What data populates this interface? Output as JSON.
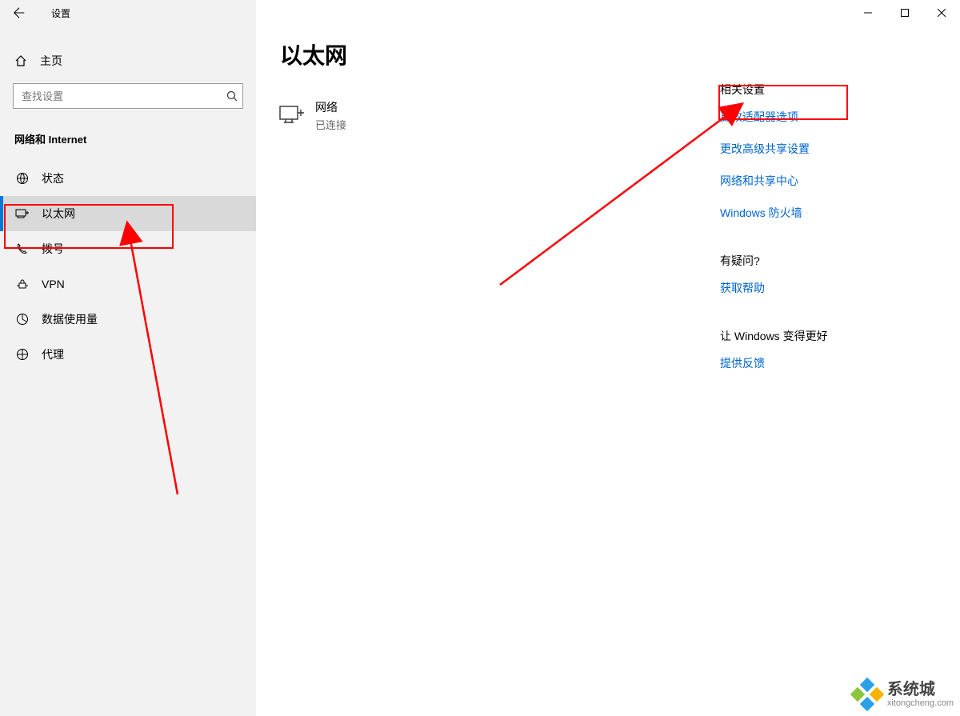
{
  "titlebar": {
    "title": "设置"
  },
  "sidebar": {
    "home_label": "主页",
    "search_placeholder": "查找设置",
    "group_title": "网络和 Internet",
    "items": [
      {
        "label": "状态"
      },
      {
        "label": "以太网"
      },
      {
        "label": "拨号"
      },
      {
        "label": "VPN"
      },
      {
        "label": "数据使用量"
      },
      {
        "label": "代理"
      }
    ]
  },
  "main": {
    "page_title": "以太网",
    "network": {
      "name": "网络",
      "status": "已连接"
    }
  },
  "rail": {
    "related_heading": "相关设置",
    "links": {
      "adapter": "更改适配器选项",
      "sharing": "更改高级共享设置",
      "center": "网络和共享中心",
      "firewall": "Windows 防火墙"
    },
    "questions_heading": "有疑问?",
    "help_link": "获取帮助",
    "improve_heading": "让 Windows 变得更好",
    "feedback_link": "提供反馈"
  },
  "watermark": {
    "brand": "系统城",
    "url": "xitongcheng.com"
  },
  "colors": {
    "accent": "#0078d7",
    "link": "#0066cc",
    "annot": "#ff0000"
  }
}
